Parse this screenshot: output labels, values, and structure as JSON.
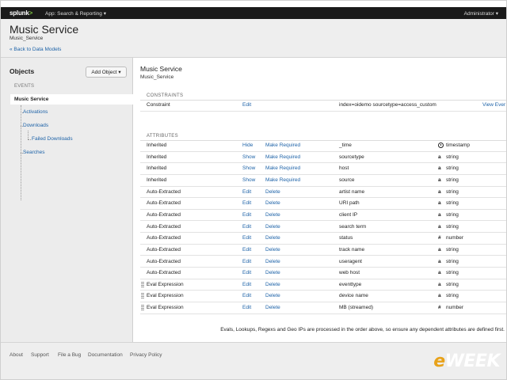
{
  "topbar": {
    "logo": "splunk>",
    "logo_main": "splunk",
    "logo_gt": ">",
    "app_label": "App: Search & Reporting",
    "user_label": "Administrator"
  },
  "header": {
    "title": "Music Service",
    "subtitle": "Music_Service",
    "back_link": "« Back to Data Models"
  },
  "sidebar": {
    "heading": "Objects",
    "add_button": "Add Object",
    "section": "EVENTS",
    "items": [
      {
        "label": "Music Service"
      },
      {
        "label": "Activations"
      },
      {
        "label": "Downloads"
      },
      {
        "label": "Failed Downloads"
      },
      {
        "label": "Searches"
      }
    ]
  },
  "object": {
    "title": "Music Service",
    "name": "Music_Service"
  },
  "constraints": {
    "label": "CONSTRAINTS",
    "rows": [
      {
        "type": "Constraint",
        "action1": "Edit",
        "value": "index=oidemo sourcetype=access_custom",
        "view": "View Ever"
      }
    ]
  },
  "attributes": {
    "label": "ATTRIBUTES",
    "rows": [
      {
        "type": "Inherited",
        "action1": "Hide",
        "action2": "Make Required",
        "name": "_time",
        "icon": "clock-icon",
        "icon_glyph": "",
        "dtype": "timestamp"
      },
      {
        "type": "Inherited",
        "action1": "Show",
        "action2": "Make Required",
        "name": "sourcetype",
        "icon": "string-icon",
        "icon_glyph": "a",
        "dtype": "string"
      },
      {
        "type": "Inherited",
        "action1": "Show",
        "action2": "Make Required",
        "name": "host",
        "icon": "string-icon",
        "icon_glyph": "a",
        "dtype": "string"
      },
      {
        "type": "Inherited",
        "action1": "Show",
        "action2": "Make Required",
        "name": "source",
        "icon": "string-icon",
        "icon_glyph": "a",
        "dtype": "string"
      },
      {
        "type": "Auto-Extracted",
        "action1": "Edit",
        "action2": "Delete",
        "name": "artist name",
        "icon": "string-icon",
        "icon_glyph": "a",
        "dtype": "string"
      },
      {
        "type": "Auto-Extracted",
        "action1": "Edit",
        "action2": "Delete",
        "name": "URI path",
        "icon": "string-icon",
        "icon_glyph": "a",
        "dtype": "string"
      },
      {
        "type": "Auto-Extracted",
        "action1": "Edit",
        "action2": "Delete",
        "name": "client IP",
        "icon": "string-icon",
        "icon_glyph": "a",
        "dtype": "string"
      },
      {
        "type": "Auto-Extracted",
        "action1": "Edit",
        "action2": "Delete",
        "name": "search term",
        "icon": "string-icon",
        "icon_glyph": "a",
        "dtype": "string"
      },
      {
        "type": "Auto-Extracted",
        "action1": "Edit",
        "action2": "Delete",
        "name": "status",
        "icon": "number-icon",
        "icon_glyph": "#",
        "dtype": "number"
      },
      {
        "type": "Auto-Extracted",
        "action1": "Edit",
        "action2": "Delete",
        "name": "track name",
        "icon": "string-icon",
        "icon_glyph": "a",
        "dtype": "string"
      },
      {
        "type": "Auto-Extracted",
        "action1": "Edit",
        "action2": "Delete",
        "name": "useragent",
        "icon": "string-icon",
        "icon_glyph": "a",
        "dtype": "string"
      },
      {
        "type": "Auto-Extracted",
        "action1": "Edit",
        "action2": "Delete",
        "name": "web host",
        "icon": "string-icon",
        "icon_glyph": "a",
        "dtype": "string"
      },
      {
        "type": "Eval Expression",
        "action1": "Edit",
        "action2": "Delete",
        "name": "eventtype",
        "icon": "string-icon",
        "icon_glyph": "a",
        "dtype": "string"
      },
      {
        "type": "Eval Expression",
        "action1": "Edit",
        "action2": "Delete",
        "name": "device name",
        "icon": "string-icon",
        "icon_glyph": "a",
        "dtype": "string"
      },
      {
        "type": "Eval Expression",
        "action1": "Edit",
        "action2": "Delete",
        "name": "MB (streamed)",
        "icon": "number-icon",
        "icon_glyph": "#",
        "dtype": "number"
      }
    ]
  },
  "footnote": "Evals, Lookups, Regexs and Geo IPs are processed in the order above, so ensure any dependent attributes are defined first.",
  "footer": {
    "links": [
      "About",
      "Support",
      "File a Bug",
      "Documentation",
      "Privacy Policy"
    ]
  },
  "watermark": {
    "text": "eWEEK",
    "e": "e",
    "rest": "WEEK"
  }
}
